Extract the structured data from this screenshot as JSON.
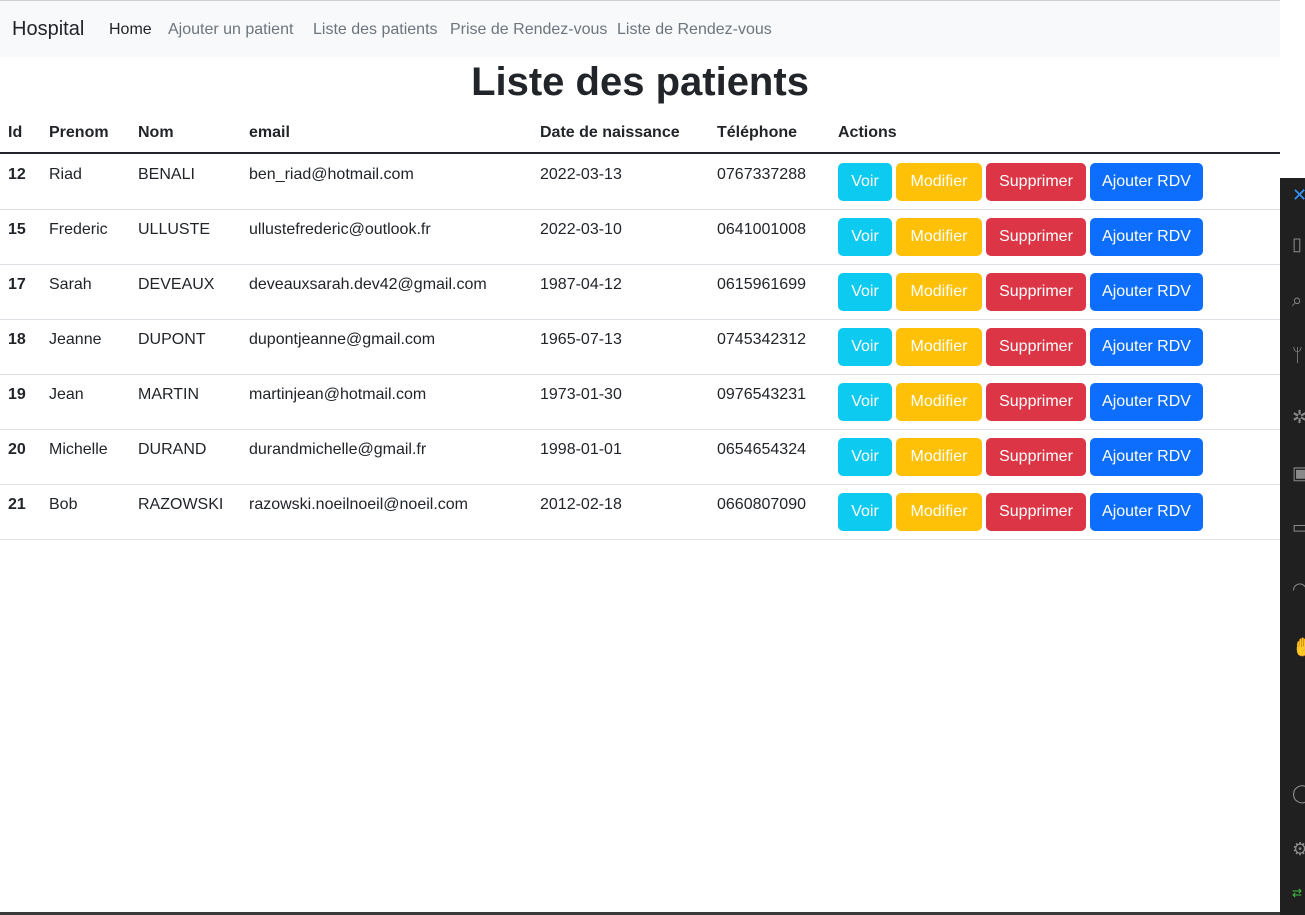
{
  "navbar": {
    "brand": "Hospital",
    "links": [
      "Home",
      "Ajouter un patient",
      "Liste des patients",
      "Prise de Rendez-vous",
      "Liste de Rendez-vous"
    ]
  },
  "page_title": "Liste des patients",
  "table": {
    "headers": [
      "Id",
      "Prenom",
      "Nom",
      "email",
      "Date de naissance",
      "Téléphone",
      "Actions"
    ],
    "rows": [
      [
        "12",
        "Riad",
        "BENALI",
        "ben_riad@hotmail.com",
        "2022-03-13",
        "0767337288"
      ],
      [
        "15",
        "Frederic",
        "ULLUSTE",
        "ullustefrederic@outlook.fr",
        "2022-03-10",
        "0641001008"
      ],
      [
        "17",
        "Sarah",
        "DEVEAUX",
        "deveauxsarah.dev42@gmail.com",
        "1987-04-12",
        "0615961699"
      ],
      [
        "18",
        "Jeanne",
        "DUPONT",
        "dupontjeanne@gmail.com",
        "1965-07-13",
        "0745342312"
      ],
      [
        "19",
        "Jean",
        "MARTIN",
        "martinjean@hotmail.com",
        "1973-01-30",
        "0976543231"
      ],
      [
        "20",
        "Michelle",
        "DURAND",
        "durandmichelle@gmail.fr",
        "1998-01-01",
        "0654654324"
      ],
      [
        "21",
        "Bob",
        "RAZOWSKI",
        "razowski.noeilnoeil@noeil.com",
        "2012-02-18",
        "0660807090"
      ]
    ],
    "actions": {
      "view": "Voir",
      "edit": "Modifier",
      "delete": "Supprimer",
      "add_rdv": "Ajouter RDV"
    }
  },
  "colors": {
    "view": "#0dcaf0",
    "edit": "#ffc107",
    "delete": "#dc3545",
    "add_rdv": "#0d6efd"
  },
  "side_panel_icons": [
    "close-icon",
    "files-icon",
    "search-icon",
    "source-control-icon",
    "debug-icon",
    "extensions-icon",
    "remote-icon",
    "broadcast-icon",
    "hand-icon",
    "account-icon",
    "settings-icon"
  ]
}
